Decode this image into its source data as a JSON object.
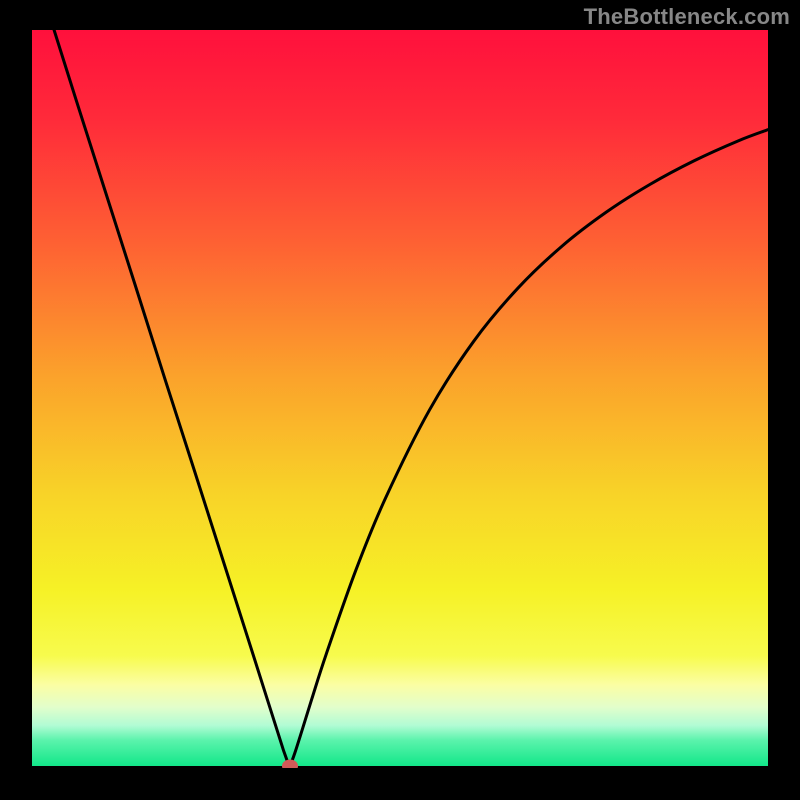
{
  "watermark": "TheBottleneck.com",
  "palette": {
    "black": "#000000",
    "curve": "#000000",
    "marker": "#d15a58",
    "gradient_stops": [
      {
        "offset": 0.0,
        "color": "#ff103c"
      },
      {
        "offset": 0.12,
        "color": "#ff2a3a"
      },
      {
        "offset": 0.29,
        "color": "#fe6133"
      },
      {
        "offset": 0.47,
        "color": "#fba22b"
      },
      {
        "offset": 0.63,
        "color": "#f8d328"
      },
      {
        "offset": 0.76,
        "color": "#f6f126"
      },
      {
        "offset": 0.85,
        "color": "#f7fb4d"
      },
      {
        "offset": 0.89,
        "color": "#fbfea4"
      },
      {
        "offset": 0.92,
        "color": "#e2fecb"
      },
      {
        "offset": 0.945,
        "color": "#b1fcd4"
      },
      {
        "offset": 0.965,
        "color": "#5bf3ac"
      },
      {
        "offset": 1.0,
        "color": "#12e789"
      }
    ]
  },
  "chart_data": {
    "type": "line",
    "title": "",
    "xlabel": "",
    "ylabel": "",
    "xlim": [
      0,
      100
    ],
    "ylim": [
      0,
      100
    ],
    "grid": false,
    "series": [
      {
        "name": "bottleneck-curve",
        "x": [
          3,
          6,
          10,
          14,
          18,
          22,
          26,
          30,
          32,
          33.5,
          34.2,
          34.7,
          35.0,
          35.3,
          35.8,
          36.5,
          38,
          40,
          44,
          48,
          54,
          60,
          66,
          72,
          78,
          84,
          90,
          96,
          100
        ],
        "y": [
          100,
          90.5,
          78.0,
          65.5,
          52.9,
          40.5,
          28.0,
          15.5,
          9.2,
          4.5,
          2.3,
          0.9,
          0.3,
          0.9,
          2.3,
          4.5,
          9.3,
          15.5,
          26.8,
          36.5,
          48.5,
          57.8,
          65.0,
          70.7,
          75.3,
          79.1,
          82.3,
          85.0,
          86.5
        ]
      }
    ],
    "markers": [
      {
        "name": "critical-point",
        "x": 35.0,
        "y": 0.3
      }
    ]
  }
}
